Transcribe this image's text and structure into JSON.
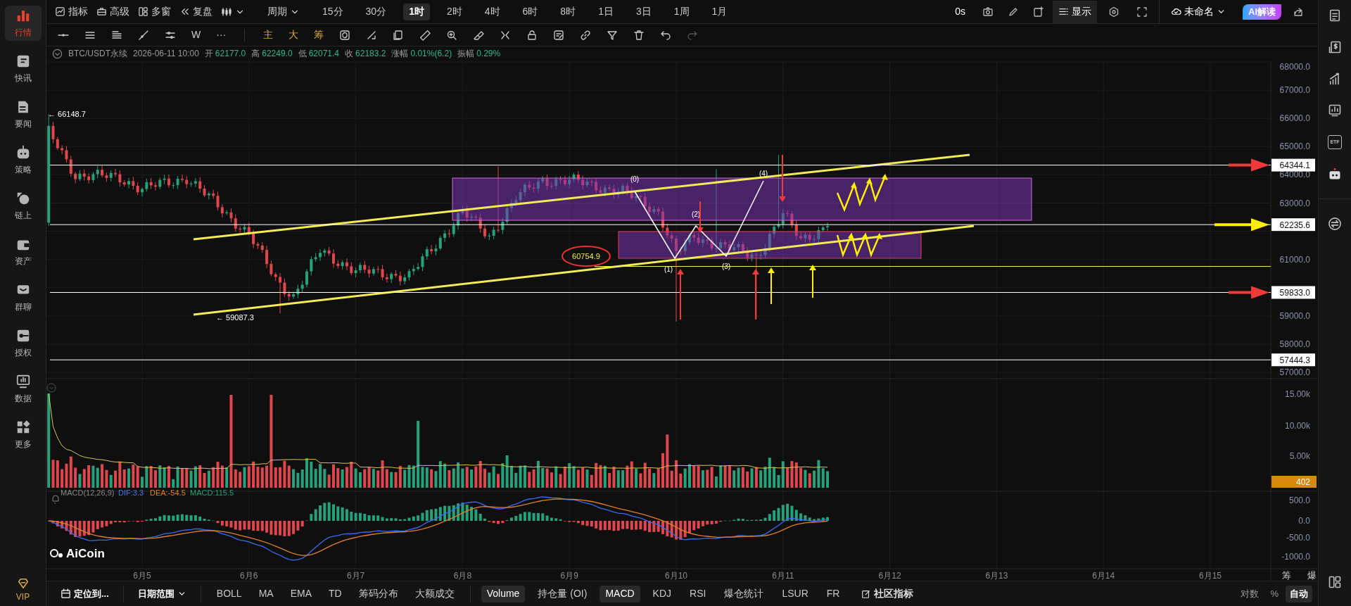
{
  "sidebar": [
    {
      "label": "行情",
      "selected": true
    },
    {
      "label": "快讯",
      "selected": false
    },
    {
      "label": "要闻",
      "selected": false
    },
    {
      "label": "策略",
      "selected": false
    },
    {
      "label": "链上",
      "selected": false
    },
    {
      "label": "资产",
      "selected": false
    },
    {
      "label": "群聊",
      "selected": false
    },
    {
      "label": "授权",
      "selected": false
    },
    {
      "label": "数据",
      "selected": false
    },
    {
      "label": "更多",
      "selected": false
    }
  ],
  "vip": "VIP",
  "menu": [
    "指标",
    "高级",
    "多窗",
    "复盘"
  ],
  "period_label": "周期",
  "intervals": [
    {
      "label": "15分",
      "selected": false
    },
    {
      "label": "30分",
      "selected": false
    },
    {
      "label": "1时",
      "selected": true
    },
    {
      "label": "2时",
      "selected": false
    },
    {
      "label": "4时",
      "selected": false
    },
    {
      "label": "6时",
      "selected": false
    },
    {
      "label": "8时",
      "selected": false
    },
    {
      "label": "1日",
      "selected": false
    },
    {
      "label": "3日",
      "selected": false
    },
    {
      "label": "1周",
      "selected": false
    },
    {
      "label": "1月",
      "selected": false
    }
  ],
  "top_right": {
    "timer": "0s",
    "display": "显示",
    "layout_name": "未命名",
    "ai_button": "AI解读"
  },
  "drawing_tools": {
    "text_tools": [
      "W",
      "···"
    ],
    "modes": [
      "主",
      "大",
      "筹"
    ]
  },
  "symbol_info": {
    "symbol": "BTC/USDT永续",
    "time": "2026-06-11 10:00",
    "fields": [
      {
        "label": "开",
        "value": "62177.0"
      },
      {
        "label": "高",
        "value": "62249.0"
      },
      {
        "label": "低",
        "value": "62071.4"
      },
      {
        "label": "收",
        "value": "62183.2"
      },
      {
        "label": "涨幅",
        "value": "0.01%(6.2)"
      },
      {
        "label": "振幅",
        "value": "0.29%"
      }
    ]
  },
  "price_axis": [
    "68000.0",
    "67000.0",
    "66000.0",
    "65000.0",
    "64000.0",
    "63000.0",
    "61000.0",
    "59000.0",
    "58000.0",
    "57000.0"
  ],
  "price_levels": [
    {
      "value": "64344.1",
      "color": "#f03a3a"
    },
    {
      "value": "62235.6",
      "color": "#ffee00"
    },
    {
      "value": "59833.0",
      "color": "#f03a3a"
    },
    {
      "value": "57444.3"
    }
  ],
  "annotations": {
    "high": "← 66148.7",
    "low": "← 59087.3",
    "support": "60754.9",
    "wave_labels": [
      "(0)",
      "(1)",
      "(2)",
      "(3)",
      "(4)"
    ]
  },
  "volume": {
    "axis": [
      "15.00k",
      "10.00k",
      "5.00k"
    ],
    "last": "402"
  },
  "macd": {
    "title": "MACD(12,26,9)",
    "dif": "DIF:3.3",
    "dea": "DEA:-54.5",
    "macd": "MACD:115.5",
    "axis": [
      "500.0",
      "0.0",
      "-500.0",
      "-1000.0"
    ]
  },
  "logo": "AiCoin",
  "dates": [
    "6月5",
    "6月6",
    "6月7",
    "6月8",
    "6月9",
    "6月10",
    "6月11",
    "6月12",
    "6月13",
    "6月14",
    "6月15"
  ],
  "corner_labels": [
    "筹",
    "爆"
  ],
  "bottom_bar": {
    "locate": "定位到...",
    "range": "日期范围",
    "overlays": [
      "BOLL",
      "MA",
      "EMA",
      "TD",
      "筹码分布",
      "大额成交"
    ],
    "panes": [
      {
        "label": "Volume",
        "selected": true
      },
      {
        "label": "持仓量 (OI)",
        "selected": false
      },
      {
        "label": "MACD",
        "selected": true
      },
      {
        "label": "KDJ",
        "selected": false
      },
      {
        "label": "RSI",
        "selected": false
      },
      {
        "label": "爆仓统计",
        "selected": false
      },
      {
        "label": "LSUR",
        "selected": false
      },
      {
        "label": "FR",
        "selected": false
      }
    ],
    "community": "社区指标",
    "scale": [
      {
        "label": "对数",
        "selected": false
      },
      {
        "label": "%",
        "selected": false
      },
      {
        "label": "自动",
        "selected": true
      }
    ]
  },
  "right_sidebar": {
    "etf_label": "ETF"
  }
}
